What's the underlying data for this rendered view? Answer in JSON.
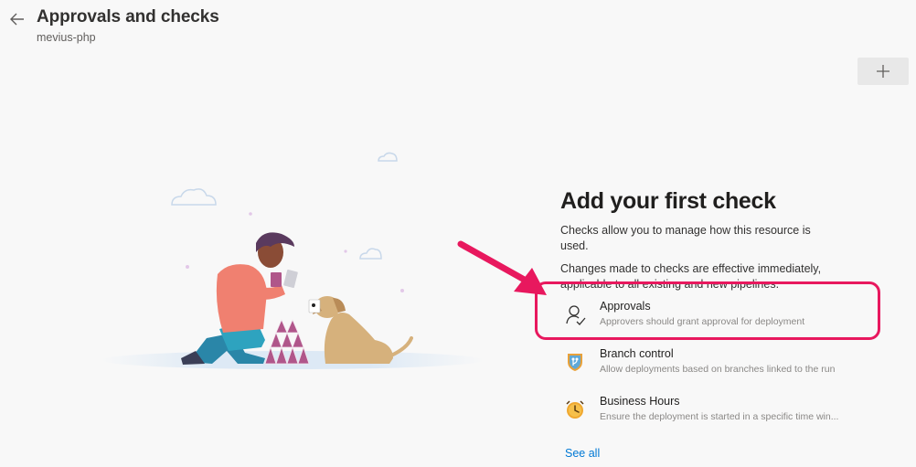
{
  "header": {
    "title": "Approvals and checks",
    "subtitle": "mevius-php",
    "back_icon": "arrow-left-icon",
    "add_icon": "plus-icon"
  },
  "panel": {
    "title": "Add your first check",
    "description": "Checks allow you to manage how this resource is used.",
    "description2": "Changes made to checks are effective immediately, applicable to all existing and new pipelines."
  },
  "checks": [
    {
      "name": "Approvals",
      "description": "Approvers should grant approval for deployment",
      "icon": "person-check-icon"
    },
    {
      "name": "Branch control",
      "description": "Allow deployments based on branches linked to the run",
      "icon": "branch-shield-icon"
    },
    {
      "name": "Business Hours",
      "description": "Ensure the deployment is started in a specific time win...",
      "icon": "clock-icon"
    }
  ],
  "see_all": "See all",
  "colors": {
    "accent": "#0078d4",
    "annotation": "#e8185e",
    "background": "#f8f8f8"
  }
}
